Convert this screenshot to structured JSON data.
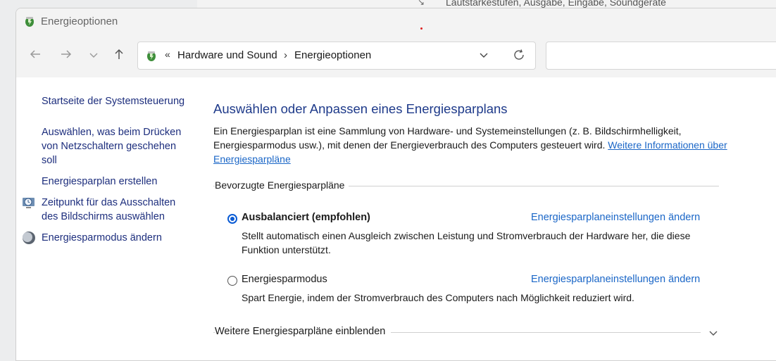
{
  "background": {
    "partial_text": "Lautstärkestufen, Ausgabe, Eingabe, Soundgeräte"
  },
  "window": {
    "title": "Energieoptionen"
  },
  "navigation": {
    "back_icon": "arrow-left-icon",
    "forward_icon": "arrow-right-icon",
    "recent_icon": "chevron-down-icon",
    "up_icon": "arrow-up-icon"
  },
  "address_bar": {
    "overflow": "«",
    "breadcrumbs": [
      {
        "label": "Hardware und Sound"
      },
      {
        "label": "Energieoptionen"
      }
    ],
    "separator": "›"
  },
  "sidebar": {
    "items": [
      {
        "label": "Startseite der Systemsteuerung"
      },
      {
        "label": "Auswählen, was beim Drücken von Netzschaltern geschehen soll"
      },
      {
        "label": "Energiesparplan erstellen"
      },
      {
        "label": "Zeitpunkt für das Ausschalten des Bildschirms auswählen",
        "icon": "monitor-clock-icon"
      },
      {
        "label": "Energiesparmodus ändern",
        "icon": "moon-icon"
      }
    ]
  },
  "main": {
    "heading": "Auswählen oder Anpassen eines Energiesparplans",
    "description": "Ein Energiesparplan ist eine Sammlung von Hardware- und Systemeinstellungen (z. B. Bildschirmhelligkeit, Energiesparmodus usw.), mit denen der Energieverbrauch des Computers gesteuert wird.",
    "more_info_link": "Weitere Informationen über Energiesparpläne",
    "group_label": "Bevorzugte Energiesparpläne",
    "plans": [
      {
        "name": "Ausbalanciert (empfohlen)",
        "selected": true,
        "link": "Energiesparplaneinstellungen ändern",
        "description": "Stellt automatisch einen Ausgleich zwischen Leistung und Stromverbrauch der Hardware her, die diese Funktion unterstützt."
      },
      {
        "name": "Energiesparmodus",
        "selected": false,
        "link": "Energiesparplaneinstellungen ändern",
        "description": "Spart Energie, indem der Stromverbrauch des Computers nach Möglichkeit reduziert wird."
      }
    ],
    "more_plans_label": "Weitere Energiesparpläne einblenden"
  },
  "colors": {
    "accent": "#0a5bd4",
    "link": "#1a66c7",
    "heading": "#1e3a8a",
    "sidebar_link": "#1d2e7d"
  }
}
